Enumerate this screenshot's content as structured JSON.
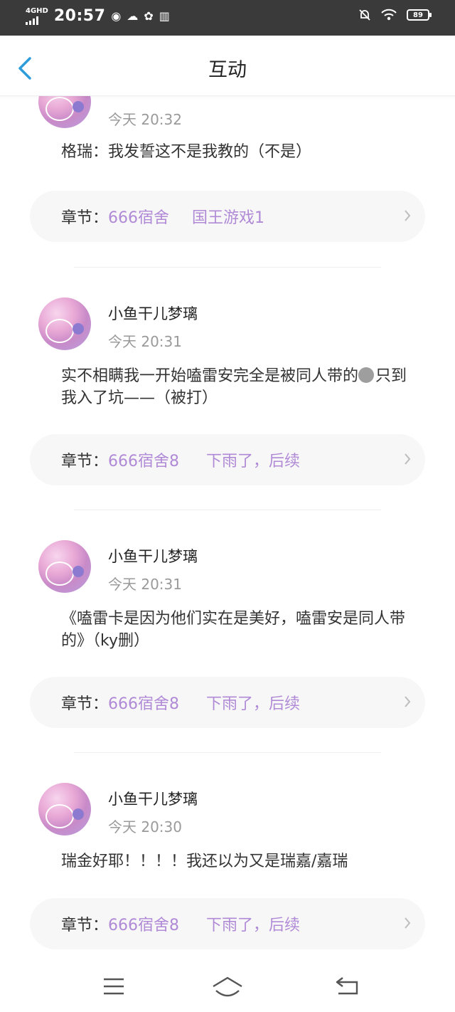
{
  "status_bar": {
    "network": "4GHD",
    "time": "20:57",
    "battery": "89"
  },
  "header": {
    "title": "互动"
  },
  "comments": [
    {
      "name": "",
      "time": "今天 20:32",
      "text": "格瑞：我发誓这不是我教的（不是）",
      "chapter_label": "章节：",
      "book": "666宿舍",
      "chapter": "国王游戏1"
    },
    {
      "name": "小鱼干儿梦璃",
      "time": "今天 20:31",
      "text": "实不相瞒我一开始嗑雷安完全是被同人带的🌚只到我入了坑——（被打）",
      "text_before_emoji": "实不相瞒我一开始嗑雷安完全是被同人带的",
      "text_after_emoji": "只到我入了坑——（被打）",
      "chapter_label": "章节：",
      "book": "666宿舍8",
      "chapter": "下雨了，后续"
    },
    {
      "name": "小鱼干儿梦璃",
      "time": "今天 20:31",
      "text": "《嗑雷卡是因为他们实在是美好，嗑雷安是同人带的》（ky删）",
      "chapter_label": "章节：",
      "book": "666宿舍8",
      "chapter": "下雨了，后续"
    },
    {
      "name": "小鱼干儿梦璃",
      "time": "今天 20:30",
      "text": "瑞金好耶！！！！我还以为又是瑞嘉/嘉瑞",
      "chapter_label": "章节：",
      "book": "666宿舍8",
      "chapter": "下雨了，后续"
    }
  ],
  "colors": {
    "accent": "#b08ad6",
    "back_arrow": "#2d9cdb",
    "status_bar_bg": "#3a3a3a"
  },
  "icons": {
    "back": "chevron-left-icon",
    "chapter_arrow": "chevron-right-icon",
    "nav_menu": "menu-icon",
    "nav_home": "home-icon",
    "nav_back": "back-icon"
  }
}
